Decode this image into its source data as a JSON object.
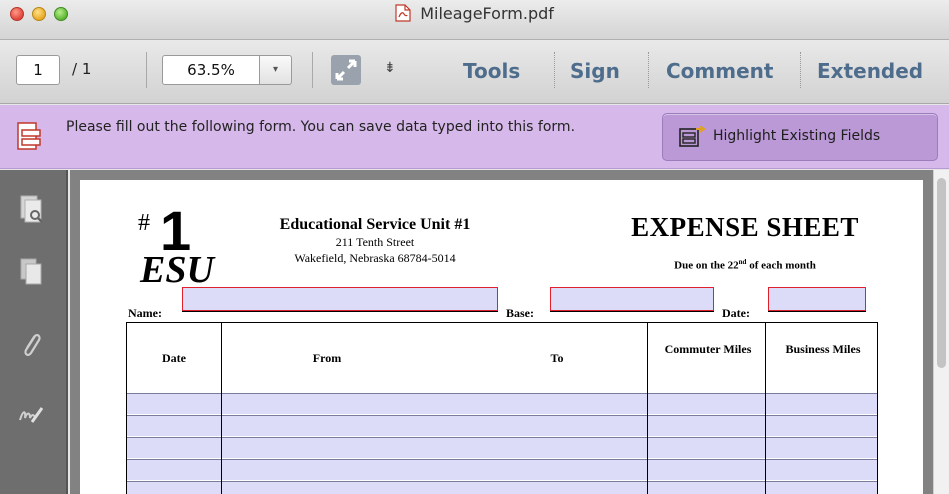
{
  "window": {
    "title": "MileageForm.pdf",
    "title_icon": "pdf-file-icon"
  },
  "toolbar": {
    "current_page": "1",
    "page_total": "/ 1",
    "zoom": "63.5%",
    "zoom_dropdown_glyph": "▾",
    "more_glyph": "⇟",
    "tools": "Tools",
    "sign": "Sign",
    "comment": "Comment",
    "extended": "Extended"
  },
  "formbar": {
    "message": "Please fill out the following form. You can save data typed into this form.",
    "highlight_button": "Highlight Existing Fields"
  },
  "sidebar": {
    "icons": [
      "page-thumbnails-icon",
      "copy-pages-icon",
      "attachments-icon",
      "signature-icon"
    ]
  },
  "document": {
    "org_name": "Educational Service Unit #1",
    "org_address1": "211 Tenth Street",
    "org_address2": "Wakefield, Nebraska  68784-5014",
    "sheet_title": "EXPENSE SHEET",
    "due_prefix": "Due on the 22",
    "due_sup": "nd",
    "due_suffix": " of each month",
    "logo_hash": "#",
    "logo_one": "1",
    "logo_text": "ESU",
    "fields": {
      "name_label": "Name:",
      "base_label": "Base:",
      "date_label": "Date:"
    },
    "table": {
      "headers": [
        "Date",
        "From",
        "To",
        "Commuter Miles",
        "Business Miles"
      ],
      "row_count": 5
    }
  },
  "colors": {
    "form_highlight": "#dcdcf8",
    "field_border": "#e0202a",
    "formbar_bg": "#d6b8ea",
    "toolbar_link": "#4e6c8c"
  }
}
